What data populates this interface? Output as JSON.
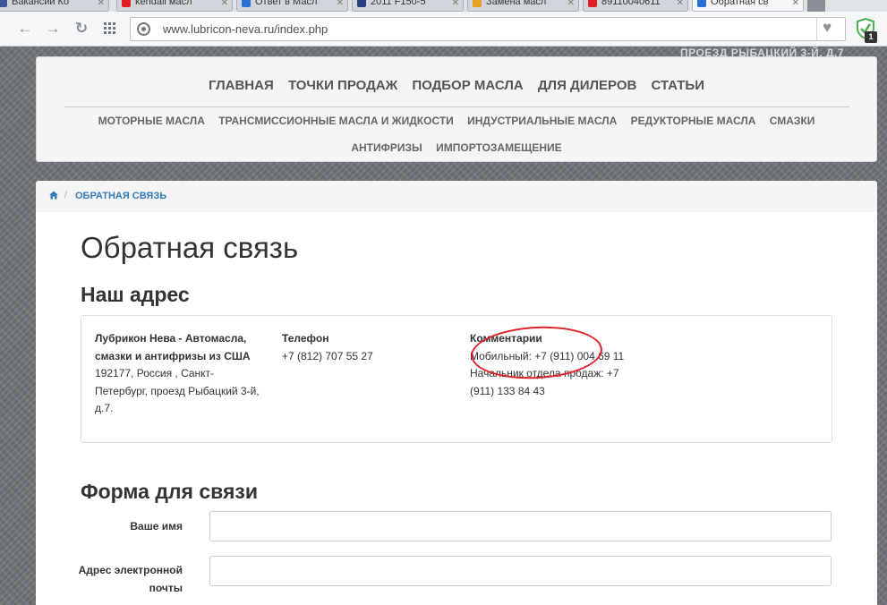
{
  "browser": {
    "tabs": [
      {
        "label": "Вакансии Ко",
        "favicon_color": "#3b5998"
      },
      {
        "label": "kendall масл",
        "favicon_color": "#e02020"
      },
      {
        "label": "Ответ в Масл",
        "favicon_color": "#2a6fd6"
      },
      {
        "label": "2011 F150-5",
        "favicon_color": "#2a3f80"
      },
      {
        "label": "Замена масл",
        "favicon_color": "#e8a020"
      },
      {
        "label": "89110040611",
        "favicon_color": "#e02020"
      },
      {
        "label": "Обратная св",
        "favicon_color": "#2a6fd6"
      }
    ],
    "url": "www.lubricon-neva.ru/index.php",
    "extension_badge": "1"
  },
  "header_corner_text": "ПРОЕЗД РЫБАЦКИЙ 3-Й, Д.7",
  "nav": {
    "main": [
      "ГЛАВНАЯ",
      "ТОЧКИ ПРОДАЖ",
      "ПОДБОР МАСЛА",
      "ДЛЯ ДИЛЕРОВ",
      "СТАТЬИ"
    ],
    "sub_row1": [
      "МОТОРНЫЕ МАСЛА",
      "ТРАНСМИССИОННЫЕ МАСЛА И ЖИДКОСТИ",
      "ИНДУСТРИАЛЬНЫЕ МАСЛА",
      "РЕДУКТОРНЫЕ МАСЛА",
      "СМАЗКИ"
    ],
    "sub_row2": [
      "АНТИФРИЗЫ",
      "ИМПОРТОЗАМЕЩЕНИЕ"
    ]
  },
  "breadcrumb": {
    "separator": "/",
    "current": "ОБРАТНАЯ СВЯЗЬ"
  },
  "page_title": "Обратная связь",
  "address": {
    "heading": "Наш адрес",
    "company_name": "Лубрикон Нева - Автомасла, смазки и антифризы из США",
    "company_address": "192177, Россия , Санкт-Петербург, проезд Рыбацкий 3-й, д.7.",
    "phone_label": "Телефон",
    "phone_value": "+7 (812) 707 55 27",
    "comments_label": "Комментарии",
    "comments_mobile": "Мобильный: +7 (911) 004 69 11",
    "comments_sales": "Начальник отдела продаж: +7 (911) 133 84 43"
  },
  "form": {
    "heading": "Форма для связи",
    "name_label": "Ваше имя",
    "email_label": "Адрес электронной почты"
  },
  "colors": {
    "link": "#337ab7",
    "annotation_circle": "#e0202a"
  }
}
